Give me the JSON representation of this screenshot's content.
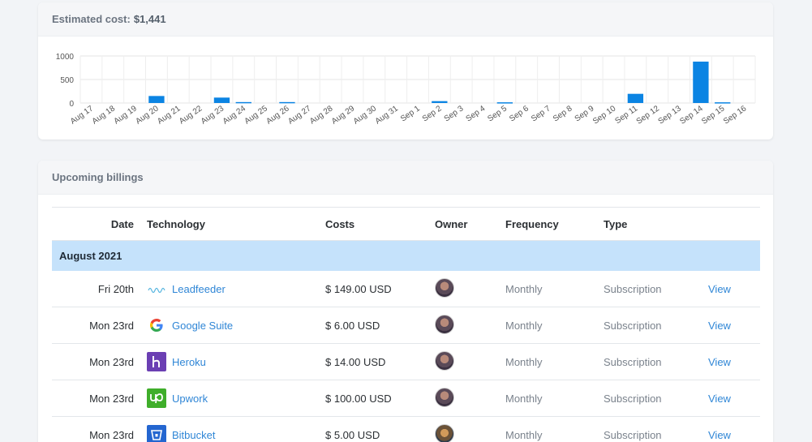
{
  "cost_card": {
    "label": "Estimated cost:",
    "amount": "$1,441"
  },
  "chart_data": {
    "type": "bar",
    "categories": [
      "Aug 17",
      "Aug 18",
      "Aug 19",
      "Aug 20",
      "Aug 21",
      "Aug 22",
      "Aug 23",
      "Aug 24",
      "Aug 25",
      "Aug 26",
      "Aug 27",
      "Aug 28",
      "Aug 29",
      "Aug 30",
      "Aug 31",
      "Sep 1",
      "Sep 2",
      "Sep 3",
      "Sep 4",
      "Sep 5",
      "Sep 6",
      "Sep 7",
      "Sep 8",
      "Sep 9",
      "Sep 10",
      "Sep 11",
      "Sep 12",
      "Sep 13",
      "Sep 14",
      "Sep 15",
      "Sep 16"
    ],
    "values": [
      0,
      0,
      0,
      149,
      0,
      0,
      115,
      20,
      0,
      20,
      0,
      0,
      0,
      0,
      0,
      0,
      40,
      0,
      0,
      15,
      0,
      0,
      0,
      0,
      0,
      195,
      0,
      0,
      880,
      15,
      0
    ],
    "yticks": [
      "1000",
      "500",
      "0"
    ],
    "ylim": [
      0,
      1000
    ],
    "color": "#0b84e3",
    "grid": true
  },
  "billing": {
    "title": "Upcoming billings",
    "headers": {
      "date": "Date",
      "technology": "Technology",
      "costs": "Costs",
      "owner": "Owner",
      "frequency": "Frequency",
      "type": "Type"
    },
    "group": "August 2021",
    "rows": [
      {
        "date": "Fri 20th",
        "tech": "Leadfeeder",
        "icon": "leadfeeder-icon",
        "cost": "$ 149.00 USD",
        "frequency": "Monthly",
        "type": "Subscription",
        "action": "View"
      },
      {
        "date": "Mon 23rd",
        "tech": "Google Suite",
        "icon": "google-icon",
        "cost": "$ 6.00 USD",
        "frequency": "Monthly",
        "type": "Subscription",
        "action": "View"
      },
      {
        "date": "Mon 23rd",
        "tech": "Heroku",
        "icon": "heroku-icon",
        "cost": "$ 14.00 USD",
        "frequency": "Monthly",
        "type": "Subscription",
        "action": "View"
      },
      {
        "date": "Mon 23rd",
        "tech": "Upwork",
        "icon": "upwork-icon",
        "cost": "$ 100.00 USD",
        "frequency": "Monthly",
        "type": "Subscription",
        "action": "View"
      },
      {
        "date": "Mon 23rd",
        "tech": "Bitbucket",
        "icon": "bitbucket-icon",
        "cost": "$ 5.00 USD",
        "frequency": "Monthly",
        "type": "Subscription",
        "action": "View"
      }
    ]
  }
}
